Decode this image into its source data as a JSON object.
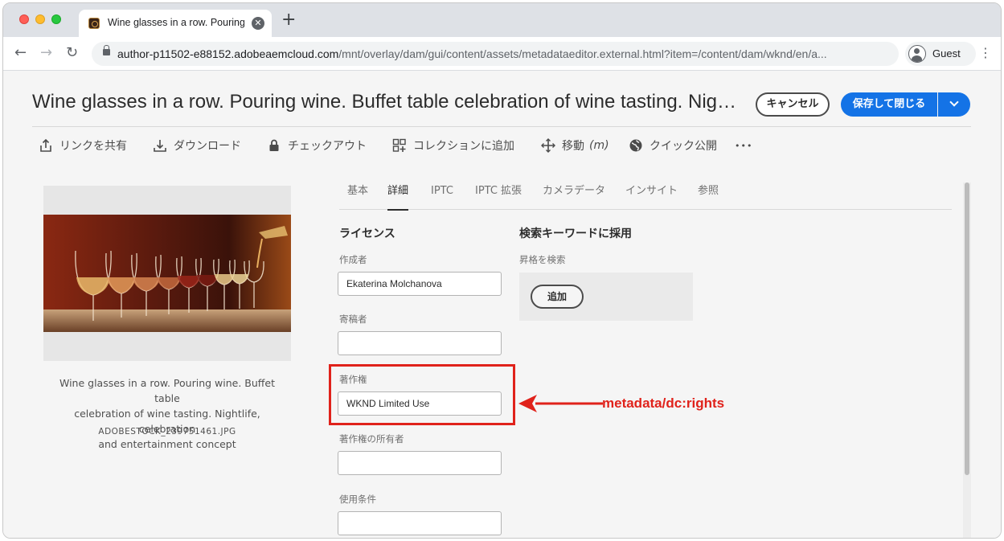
{
  "browser": {
    "tab_title": "Wine glasses in a row. Pouring",
    "url_domain": "author-p11502-e88152.adobeaemcloud.com",
    "url_path": "/mnt/overlay/dam/gui/content/assets/metadataeditor.external.html?item=/content/dam/wknd/en/a...",
    "profile_name": "Guest"
  },
  "header": {
    "asset_title": "Wine glasses in a row. Pouring wine. Buffet table celebration of wine tasting. Nig…",
    "cancel_label": "キャンセル",
    "save_label": "保存して閉じる"
  },
  "actions": {
    "share": "リンクを共有",
    "download": "ダウンロード",
    "checkout": "チェックアウト",
    "add_collection": "コレクションに追加",
    "move": "移動",
    "move_shortcut": "(m)",
    "quick_publish": "クイック公開",
    "more": "•••"
  },
  "asset": {
    "caption_line1": "Wine glasses in a row. Pouring wine. Buffet table",
    "caption_line2": "celebration of wine tasting. Nightlife, celebration",
    "caption_line3": "and entertainment concept",
    "filename": "ADOBESTOCK_239751461.JPG"
  },
  "tabs": [
    "基本",
    "詳細",
    "IPTC",
    "IPTC 拡張",
    "カメラデータ",
    "インサイト",
    "参照"
  ],
  "active_tab": "詳細",
  "license": {
    "section_title": "ライセンス",
    "creator_label": "作成者",
    "creator_value": "Ekaterina Molchanova",
    "contributor_label": "寄稿者",
    "contributor_value": "",
    "rights_label": "著作権",
    "rights_value": "WKND Limited Use",
    "rights_owner_label": "著作権の所有者",
    "rights_owner_value": "",
    "usage_terms_label": "使用条件",
    "usage_terms_value": ""
  },
  "keywords": {
    "section_title": "検索キーワードに採用",
    "sub_label": "昇格を検索",
    "add_label": "追加"
  },
  "annotation": {
    "label": "metadata/dc:rights",
    "color": "#e0221b"
  },
  "colors": {
    "accent": "#1473e6"
  }
}
